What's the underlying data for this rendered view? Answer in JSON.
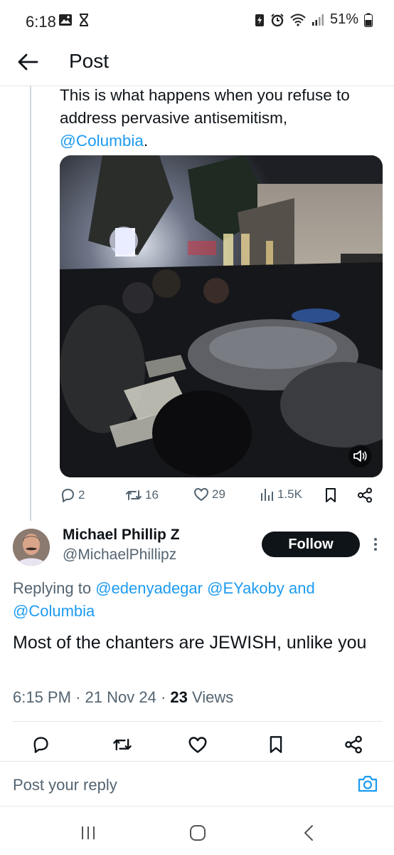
{
  "status_bar": {
    "time": "6:18",
    "battery": "51%",
    "icons": [
      "image-icon",
      "hourglass-icon",
      "battery-saver-icon",
      "alarm-icon",
      "wifi-icon",
      "signal-icon",
      "battery-icon"
    ]
  },
  "header": {
    "title": "Post"
  },
  "quoted_tweet": {
    "text_before": "This is what happens when you refuse to address pervasive antisemitism,",
    "mention": "@Columbia",
    "text_after": ".",
    "actions": {
      "replies": "2",
      "reposts": "16",
      "likes": "29",
      "views": "1.5K"
    }
  },
  "reply": {
    "author_name": "Michael Phillip Z",
    "author_handle": "@MichaelPhillipz",
    "follow_label": "Follow",
    "replying_prefix": "Replying to",
    "replying_mention_1": "@edenyadegar",
    "replying_mention_2": "@EYakoby",
    "replying_and": "and",
    "replying_mention_3": "@Columbia",
    "text": "Most of the chanters are JEWISH, unlike you",
    "time": "6:15 PM",
    "date": "21 Nov 24",
    "views_count": "23",
    "views_label": "Views"
  },
  "reply_box": {
    "placeholder": "Post your reply"
  },
  "colors": {
    "accent": "#1d9bf0",
    "text": "#0f1419",
    "secondary": "#536471"
  }
}
